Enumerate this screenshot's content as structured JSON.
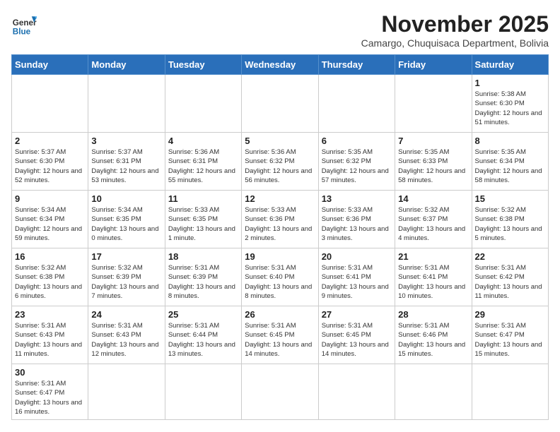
{
  "header": {
    "logo_general": "General",
    "logo_blue": "Blue",
    "month_title": "November 2025",
    "subtitle": "Camargo, Chuquisaca Department, Bolivia"
  },
  "weekdays": [
    "Sunday",
    "Monday",
    "Tuesday",
    "Wednesday",
    "Thursday",
    "Friday",
    "Saturday"
  ],
  "weeks": [
    [
      {
        "day": "",
        "info": ""
      },
      {
        "day": "",
        "info": ""
      },
      {
        "day": "",
        "info": ""
      },
      {
        "day": "",
        "info": ""
      },
      {
        "day": "",
        "info": ""
      },
      {
        "day": "",
        "info": ""
      },
      {
        "day": "1",
        "info": "Sunrise: 5:38 AM\nSunset: 6:30 PM\nDaylight: 12 hours\nand 51 minutes."
      }
    ],
    [
      {
        "day": "2",
        "info": "Sunrise: 5:37 AM\nSunset: 6:30 PM\nDaylight: 12 hours\nand 52 minutes."
      },
      {
        "day": "3",
        "info": "Sunrise: 5:37 AM\nSunset: 6:31 PM\nDaylight: 12 hours\nand 53 minutes."
      },
      {
        "day": "4",
        "info": "Sunrise: 5:36 AM\nSunset: 6:31 PM\nDaylight: 12 hours\nand 55 minutes."
      },
      {
        "day": "5",
        "info": "Sunrise: 5:36 AM\nSunset: 6:32 PM\nDaylight: 12 hours\nand 56 minutes."
      },
      {
        "day": "6",
        "info": "Sunrise: 5:35 AM\nSunset: 6:32 PM\nDaylight: 12 hours\nand 57 minutes."
      },
      {
        "day": "7",
        "info": "Sunrise: 5:35 AM\nSunset: 6:33 PM\nDaylight: 12 hours\nand 58 minutes."
      },
      {
        "day": "8",
        "info": "Sunrise: 5:35 AM\nSunset: 6:34 PM\nDaylight: 12 hours\nand 58 minutes."
      }
    ],
    [
      {
        "day": "9",
        "info": "Sunrise: 5:34 AM\nSunset: 6:34 PM\nDaylight: 12 hours\nand 59 minutes."
      },
      {
        "day": "10",
        "info": "Sunrise: 5:34 AM\nSunset: 6:35 PM\nDaylight: 13 hours\nand 0 minutes."
      },
      {
        "day": "11",
        "info": "Sunrise: 5:33 AM\nSunset: 6:35 PM\nDaylight: 13 hours\nand 1 minute."
      },
      {
        "day": "12",
        "info": "Sunrise: 5:33 AM\nSunset: 6:36 PM\nDaylight: 13 hours\nand 2 minutes."
      },
      {
        "day": "13",
        "info": "Sunrise: 5:33 AM\nSunset: 6:36 PM\nDaylight: 13 hours\nand 3 minutes."
      },
      {
        "day": "14",
        "info": "Sunrise: 5:32 AM\nSunset: 6:37 PM\nDaylight: 13 hours\nand 4 minutes."
      },
      {
        "day": "15",
        "info": "Sunrise: 5:32 AM\nSunset: 6:38 PM\nDaylight: 13 hours\nand 5 minutes."
      }
    ],
    [
      {
        "day": "16",
        "info": "Sunrise: 5:32 AM\nSunset: 6:38 PM\nDaylight: 13 hours\nand 6 minutes."
      },
      {
        "day": "17",
        "info": "Sunrise: 5:32 AM\nSunset: 6:39 PM\nDaylight: 13 hours\nand 7 minutes."
      },
      {
        "day": "18",
        "info": "Sunrise: 5:31 AM\nSunset: 6:39 PM\nDaylight: 13 hours\nand 8 minutes."
      },
      {
        "day": "19",
        "info": "Sunrise: 5:31 AM\nSunset: 6:40 PM\nDaylight: 13 hours\nand 8 minutes."
      },
      {
        "day": "20",
        "info": "Sunrise: 5:31 AM\nSunset: 6:41 PM\nDaylight: 13 hours\nand 9 minutes."
      },
      {
        "day": "21",
        "info": "Sunrise: 5:31 AM\nSunset: 6:41 PM\nDaylight: 13 hours\nand 10 minutes."
      },
      {
        "day": "22",
        "info": "Sunrise: 5:31 AM\nSunset: 6:42 PM\nDaylight: 13 hours\nand 11 minutes."
      }
    ],
    [
      {
        "day": "23",
        "info": "Sunrise: 5:31 AM\nSunset: 6:43 PM\nDaylight: 13 hours\nand 11 minutes."
      },
      {
        "day": "24",
        "info": "Sunrise: 5:31 AM\nSunset: 6:43 PM\nDaylight: 13 hours\nand 12 minutes."
      },
      {
        "day": "25",
        "info": "Sunrise: 5:31 AM\nSunset: 6:44 PM\nDaylight: 13 hours\nand 13 minutes."
      },
      {
        "day": "26",
        "info": "Sunrise: 5:31 AM\nSunset: 6:45 PM\nDaylight: 13 hours\nand 14 minutes."
      },
      {
        "day": "27",
        "info": "Sunrise: 5:31 AM\nSunset: 6:45 PM\nDaylight: 13 hours\nand 14 minutes."
      },
      {
        "day": "28",
        "info": "Sunrise: 5:31 AM\nSunset: 6:46 PM\nDaylight: 13 hours\nand 15 minutes."
      },
      {
        "day": "29",
        "info": "Sunrise: 5:31 AM\nSunset: 6:47 PM\nDaylight: 13 hours\nand 15 minutes."
      }
    ],
    [
      {
        "day": "30",
        "info": "Sunrise: 5:31 AM\nSunset: 6:47 PM\nDaylight: 13 hours\nand 16 minutes."
      },
      {
        "day": "",
        "info": ""
      },
      {
        "day": "",
        "info": ""
      },
      {
        "day": "",
        "info": ""
      },
      {
        "day": "",
        "info": ""
      },
      {
        "day": "",
        "info": ""
      },
      {
        "day": "",
        "info": ""
      }
    ]
  ]
}
